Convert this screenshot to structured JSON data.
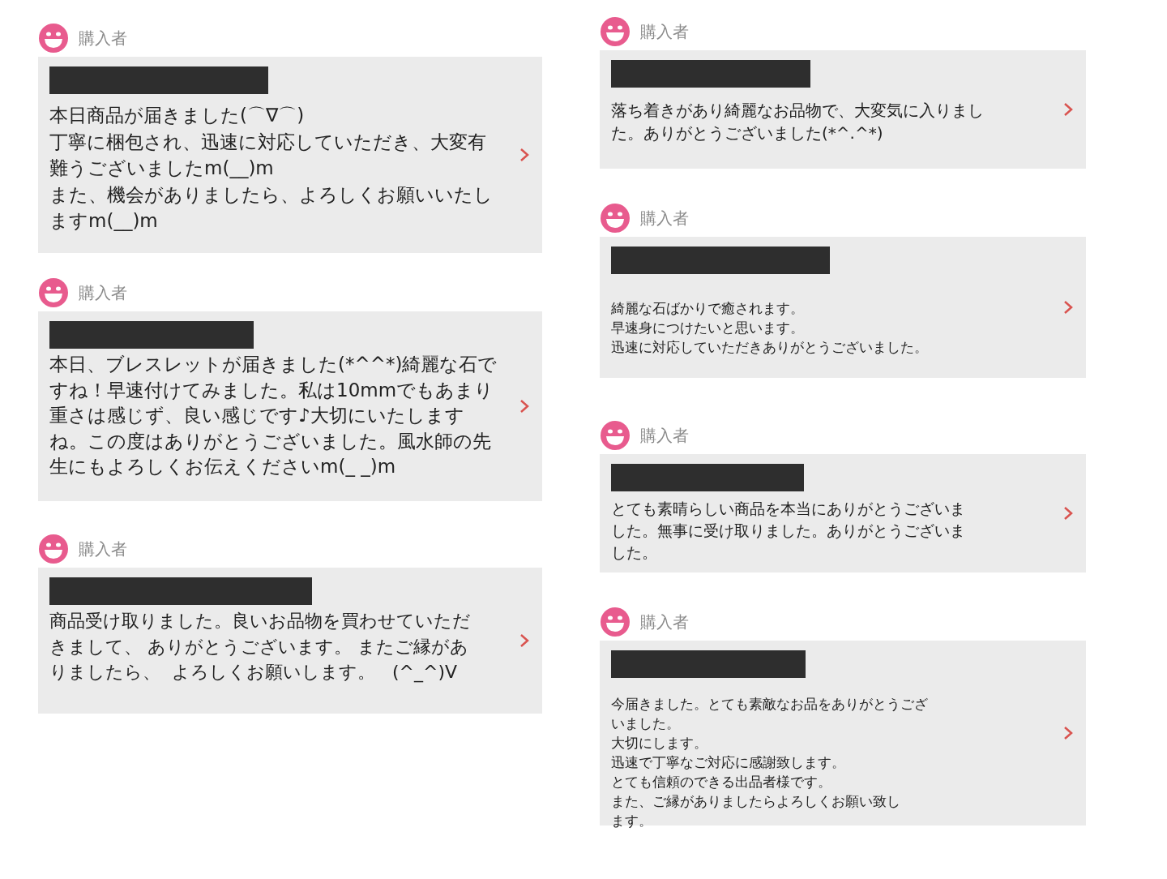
{
  "columns": [
    {
      "reviews": [
        {
          "role": "購入者",
          "lines": [
            "本日商品が届きました(⌒∇⌒)",
            "丁寧に梱包され、迅速に対応していただき、大変有",
            "難うございましたm(__)m",
            "また、機会がありましたら、よろしくお願いいたし",
            "ますm(__)m"
          ]
        },
        {
          "role": "購入者",
          "lines": [
            "本日、ブレスレットが届きました(*^^*)綺麗な石で",
            "すね！早速付けてみました。私は10mmでもあまり",
            "重さは感じず、良い感じです♪大切にいたします",
            "ね。この度はありがとうございました。風水師の先",
            "生にもよろしくお伝えくださいm(_ _)m"
          ]
        },
        {
          "role": "購入者",
          "lines": [
            "商品受け取りました。良いお品物を買わせていただ",
            "きまして、 ありがとうございます。 またご縁があ",
            "りましたら、  よろしくお願いします。   (^_^)V"
          ]
        }
      ]
    },
    {
      "reviews": [
        {
          "role": "購入者",
          "lines": [
            "落ち着きがあり綺麗なお品物で、大変気に入りまし",
            "た。ありがとうございました(*^.^*)"
          ]
        },
        {
          "role": "購入者",
          "lines": [
            "綺麗な石ばかりで癒されます。",
            "早速身につけたいと思います。",
            "迅速に対応していただきありがとうございました。"
          ]
        },
        {
          "role": "購入者",
          "lines": [
            "とても素晴らしい商品を本当にありがとうございま",
            "した。無事に受け取りました。ありがとうございま",
            "した。"
          ]
        },
        {
          "role": "購入者",
          "lines": [
            "今届きました。とても素敵なお品をありがとうござ",
            "いました。",
            "大切にします。",
            "迅速で丁寧なご対応に感謝致します。",
            "とても信頼のできる出品者様です。",
            "また、ご縁がありましたらよろしくお願い致し",
            "ます。"
          ]
        }
      ]
    }
  ]
}
